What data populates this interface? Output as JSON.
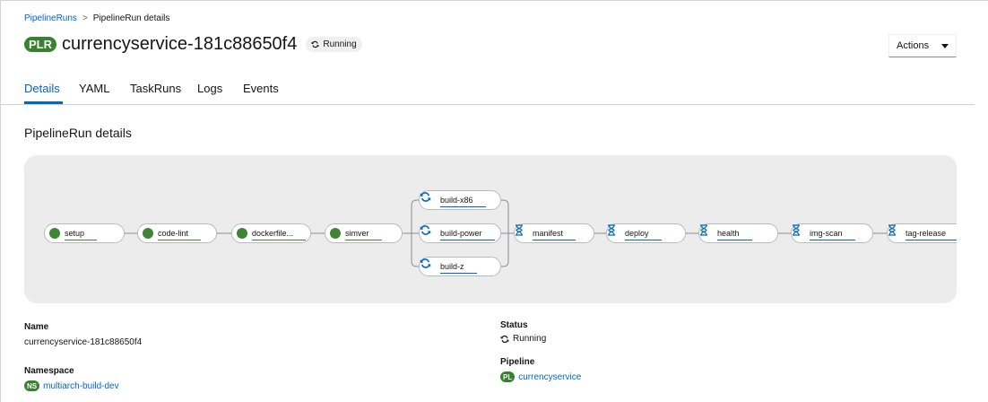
{
  "breadcrumb": {
    "parent": "PipelineRuns",
    "separator": ">",
    "current": "PipelineRun details"
  },
  "header": {
    "badge": "PLR",
    "title": "currencyservice-181c88650f4",
    "status": "Running"
  },
  "actions": {
    "label": "Actions"
  },
  "tabs": [
    "Details",
    "YAML",
    "TaskRuns",
    "Logs",
    "Events"
  ],
  "section_title": "PipelineRun details",
  "pipeline_graph": {
    "tasks": [
      {
        "name": "setup",
        "state": "succeeded"
      },
      {
        "name": "code-lint",
        "state": "succeeded"
      },
      {
        "name": "dockerfile...",
        "state": "succeeded"
      },
      {
        "name": "simver",
        "state": "succeeded"
      },
      {
        "name": "build-x86",
        "state": "running"
      },
      {
        "name": "build-power",
        "state": "running"
      },
      {
        "name": "build-z",
        "state": "running"
      },
      {
        "name": "manifest",
        "state": "pending"
      },
      {
        "name": "deploy",
        "state": "pending"
      },
      {
        "name": "health",
        "state": "pending"
      },
      {
        "name": "img-scan",
        "state": "pending"
      },
      {
        "name": "tag-release",
        "state": "pending"
      }
    ]
  },
  "details": {
    "name_label": "Name",
    "name_value": "currencyservice-181c88650f4",
    "namespace_label": "Namespace",
    "namespace_badge": "NS",
    "namespace_value": "multiarch-build-dev",
    "status_label": "Status",
    "status_value": "Running",
    "pipeline_label": "Pipeline",
    "pipeline_badge": "PL",
    "pipeline_value": "currencyservice"
  },
  "colors": {
    "success": "#3e8635",
    "running": "#0066cc",
    "pending": "#0066cc",
    "link": "#0066cc",
    "badge_bg": "#38812f"
  }
}
